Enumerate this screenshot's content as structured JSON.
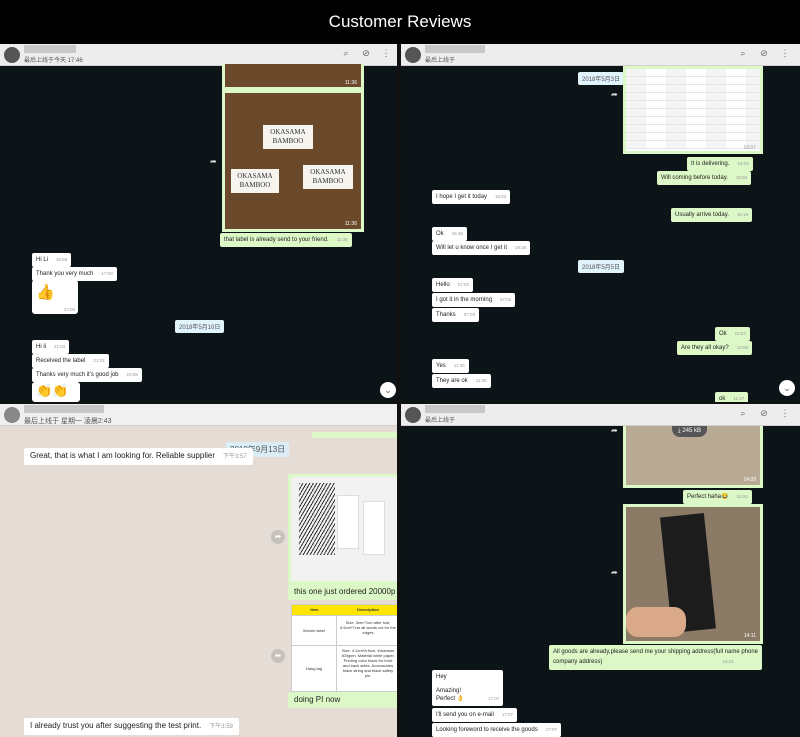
{
  "banner": {
    "title": "Customer Reviews"
  },
  "panel1": {
    "status": "最后上线于今天 17:46",
    "time_top": "11:36",
    "image_time": "11:36",
    "tag_text": "OKASAMA\nBAMBOO",
    "out_label": {
      "text": "that label is already send to your friend.",
      "time": "11:36"
    },
    "msgs": [
      {
        "text": "Hi Li",
        "time": "16:59"
      },
      {
        "text": "Thank you very much",
        "time": "17:00"
      },
      {
        "text": "Hi li",
        "time": "21:04"
      },
      {
        "text": "Received the label",
        "time": "21:04"
      },
      {
        "text": "Thanks very much it's good job",
        "time": "23:59"
      }
    ],
    "emoji_time": "17:00",
    "date_chip": "2018年5月10日",
    "thumb_emoji": "👍",
    "last_emoji": "👏👏"
  },
  "panel2": {
    "status": "最后上线于",
    "date1": "2018年5月3日",
    "sheet_time": "16:07",
    "out_msgs": [
      {
        "text": "It is delivering.",
        "time": "16:03"
      },
      {
        "text": "Will coming before today.",
        "time": "16:03"
      },
      {
        "text": "Usually arrive today.",
        "time": "16:19"
      },
      {
        "text": "Ok",
        "time": "10:07"
      },
      {
        "text": "Are they all okay?",
        "time": "10:08"
      },
      {
        "text": "ok",
        "time": "11:37"
      }
    ],
    "in_msgs": [
      {
        "text": "I hope I get it today",
        "time": "16:03"
      },
      {
        "text": "Ok",
        "time": "16:46"
      },
      {
        "text": "Will let u know once I get it",
        "time": "16:46"
      },
      {
        "text": "Hello",
        "time": "07:02"
      },
      {
        "text": "I got it in the morning",
        "time": "07:02"
      },
      {
        "text": "Thanks",
        "time": "07:03"
      },
      {
        "text": "Yes",
        "time": "11:35"
      },
      {
        "text": "They are ok",
        "time": "11:36"
      }
    ],
    "date2": "2018年5月5日"
  },
  "panel3": {
    "status": "最后上线于 星期一 凌晨2:43",
    "date": "2018年9月13日",
    "msg1": {
      "text": "Great, that is what I am looking for. Reliable supplier",
      "time": "下午3:57"
    },
    "img_caption": "this one just ordered 20000p",
    "table": {
      "headers": [
        "Item",
        "Description"
      ],
      "rows": [
        [
          "Woven label",
          "Size: 3cm*7cm after fold; 6.5cm*7cm all words cut for the edges"
        ],
        [
          "Hang tag",
          "Size: 4.2cm*8.5cm, thickness 300gsm. Material white paper. Printing color black for front and back sides. Accessories black string and black safety pin."
        ]
      ]
    },
    "msg2": {
      "text": "doing PI now"
    },
    "msg3": {
      "text": "I already trust you after suggesting the test print.",
      "time": "下午3:59"
    }
  },
  "panel4": {
    "status": "最后上线于",
    "download_size": "245 kB",
    "img1_time": "14:09",
    "perfect": {
      "text": "Perfect haha😂",
      "time": "15:04"
    },
    "img2_time": "14:11",
    "goods_msg": {
      "line1": "All goods are already,please send me your shipping address(full name phone",
      "line2": "company address)",
      "time": "16:22"
    },
    "in_msgs": [
      {
        "line1": "Hey",
        "line2": "",
        "line3": "Amazing!",
        "line4": "Perfect 👌",
        "time": "17:07"
      },
      {
        "text": "I'll send you on e-mail",
        "time": "17:07"
      },
      {
        "text": "Looking foreword to receive the goods",
        "time": "17:07"
      }
    ]
  }
}
